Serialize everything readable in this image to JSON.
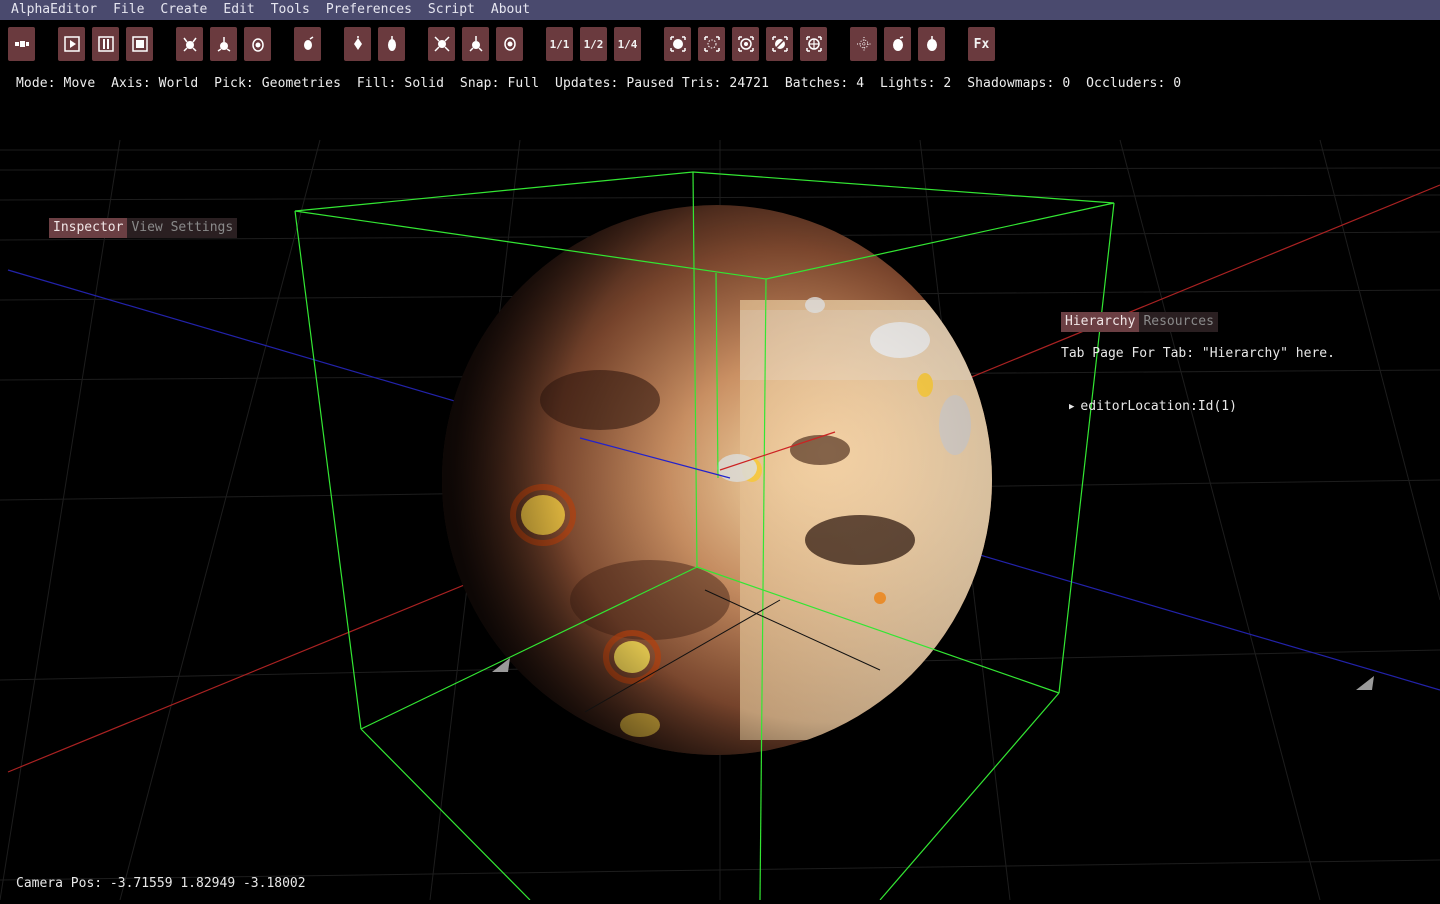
{
  "menubar": {
    "items": [
      "AlphaEditor",
      "File",
      "Create",
      "Edit",
      "Tools",
      "Preferences",
      "Script",
      "About"
    ]
  },
  "toolbar": {
    "buttons": [
      {
        "name": "entity-icon"
      },
      {
        "name": "play-icon"
      },
      {
        "name": "pause-icon"
      },
      {
        "name": "stop-icon"
      },
      {
        "name": "move-gizmo-icon"
      },
      {
        "name": "rotate-gizmo-icon"
      },
      {
        "name": "scale-gizmo-icon"
      },
      {
        "name": "pick-icon"
      },
      {
        "name": "light-icon"
      },
      {
        "name": "camera-icon"
      },
      {
        "name": "select-icon"
      },
      {
        "name": "select-2-icon"
      },
      {
        "name": "select-3-icon"
      },
      {
        "name": "snap-1-icon",
        "label": "1/1"
      },
      {
        "name": "snap-2-icon",
        "label": "1/2"
      },
      {
        "name": "snap-4-icon",
        "label": "1/4"
      },
      {
        "name": "fill-solid-icon"
      },
      {
        "name": "fill-points-icon"
      },
      {
        "name": "fill-wire-icon"
      },
      {
        "name": "fill-texture-icon"
      },
      {
        "name": "fill-normals-icon"
      },
      {
        "name": "grid-icon"
      },
      {
        "name": "sphere-icon"
      },
      {
        "name": "sphere-lit-icon"
      },
      {
        "name": "fx-icon",
        "label": "Fx"
      }
    ]
  },
  "status": {
    "text": "Mode: Move  Axis: World  Pick: Geometries  Fill: Solid  Snap: Full  Updates: Paused Tris: 24721  Batches: 4  Lights: 2  Shadowmaps: 0  Occluders: 0"
  },
  "inspector": {
    "tab_active": "Inspector",
    "tab_inactive": "View Settings"
  },
  "hierarchy": {
    "tab_active": "Hierarchy",
    "tab_inactive": "Resources",
    "content": "Tab Page For Tab: \"Hierarchy\" here.",
    "tree_item": "editorLocation:Id(1)"
  },
  "camera": {
    "text": "Camera Pos: -3.71559 1.82949 -3.18002"
  },
  "colors": {
    "menubar": "#4a4a6e",
    "button": "#6a3a3e",
    "tab_active": "#6b3f43",
    "bbox": "#33e633",
    "axis_x": "#b32a2a",
    "axis_z": "#2a2ab3"
  }
}
